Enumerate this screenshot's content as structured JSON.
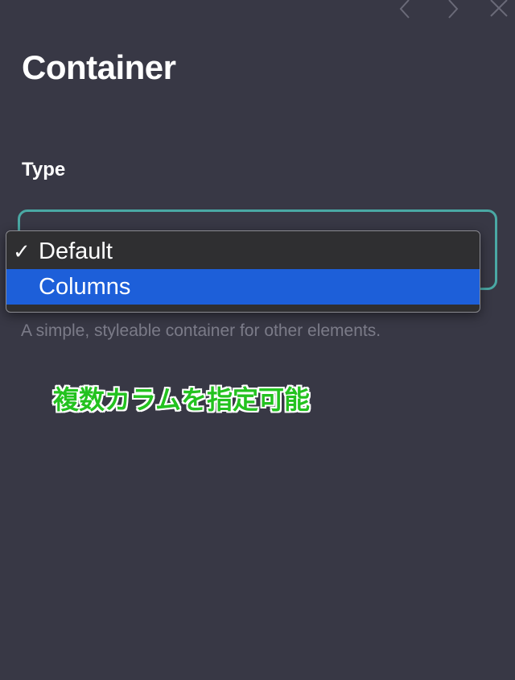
{
  "nav": {
    "prev_icon": "chevron-left-icon",
    "next_icon": "chevron-right-icon",
    "close_icon": "close-icon"
  },
  "panel": {
    "title": "Container",
    "type_label": "Type",
    "description": "A simple, styleable container for other elements."
  },
  "dropdown": {
    "options": [
      {
        "label": "Default",
        "checked": true,
        "highlighted": false
      },
      {
        "label": "Columns",
        "checked": false,
        "highlighted": true
      }
    ],
    "check_mark": "✓"
  },
  "annotation": {
    "text": "複数カラムを指定可能"
  },
  "colors": {
    "background": "#383845",
    "select_border": "#4aa8a4",
    "highlight": "#1d5fd9",
    "annotation_text": "#23c21f",
    "description_text": "#7b7b88"
  }
}
